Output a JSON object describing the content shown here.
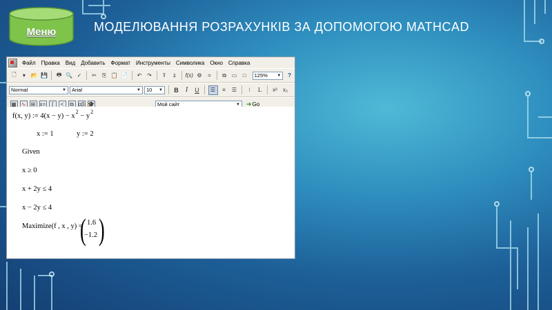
{
  "slide": {
    "title": "МОДЕЛЮВАННЯ РОЗРАХУНКІВ ЗА ДОПОМОГОЮ MATHCAD",
    "menu_button": "Меню",
    "menu_color": "#7ec34a"
  },
  "mathcad": {
    "menu": [
      "Файл",
      "Правка",
      "Вид",
      "Добавить",
      "Формат",
      "Инструменты",
      "Символика",
      "Окно",
      "Справка"
    ],
    "zoom": "125%",
    "style": "Normal",
    "font": "Arial",
    "font_size": "10",
    "resource_box": "Мой сайт",
    "go_label": "Go",
    "worksheet": {
      "func_def": "f(x, y) := 4(x − y) − x",
      "func_exp1": "2",
      "func_mid": " − y",
      "func_exp2": "2",
      "x_assign": "x := 1",
      "y_assign": "y := 2",
      "given": "Given",
      "c1": "x ≥ 0",
      "c2": "x + 2y ≤ 4",
      "c3": "x − 2y ≤ 4",
      "maximize": "Maximize(f , x , y) =",
      "result": [
        "1.6",
        "−1.2"
      ]
    }
  }
}
